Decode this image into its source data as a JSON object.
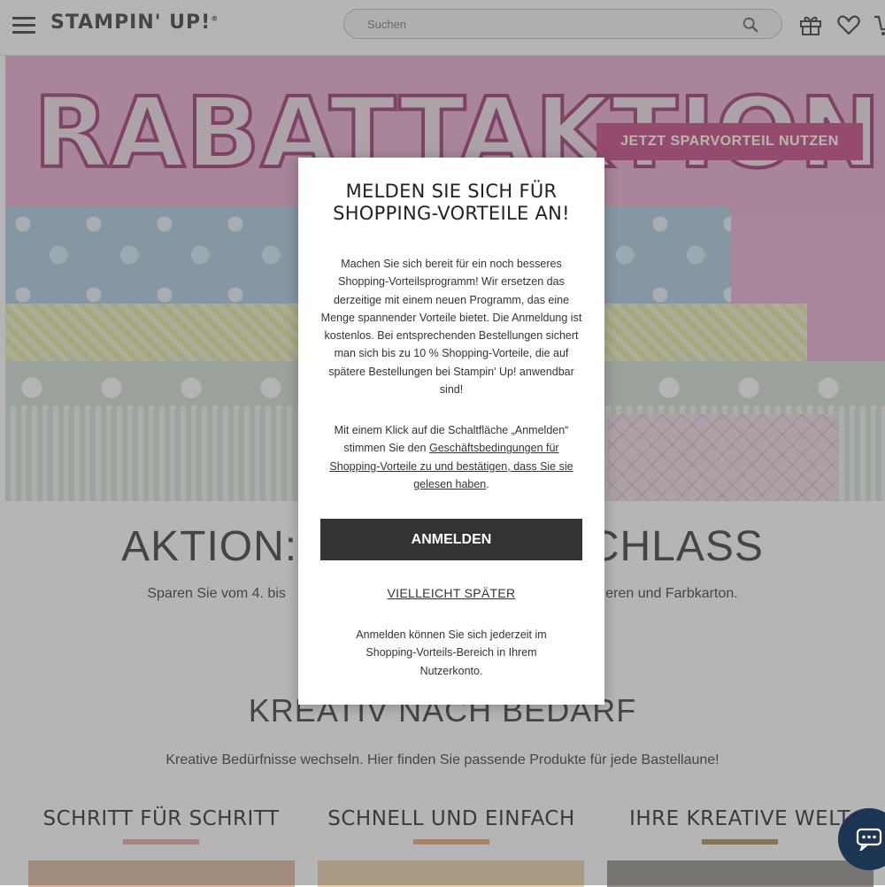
{
  "header": {
    "logo": "STAMPIN' UP!",
    "logo_mark": "®",
    "search_placeholder": "Suchen"
  },
  "icons": {
    "menu": "hamburger-icon",
    "search": "search-icon",
    "gift": "gift-icon",
    "wishlist": "heart-icon",
    "cart": "cart-icon",
    "chat": "chat-icon"
  },
  "hero": {
    "title": "RABATTAKTION",
    "button_label": "JETZT SPARVORTEIL NUTZEN"
  },
  "promo": {
    "heading": "AKTION: ... CHLASS",
    "heading_left": "AKTION:",
    "heading_right": "CHLASS",
    "subtitle_left": "Sparen Sie vom 4. bis",
    "subtitle_right": "pieren und Farbkarton."
  },
  "kreativ": {
    "heading": "KREATIV NACH BEDARF",
    "subtitle": "Kreative Bedürfnisse wechseln. Hier finden Sie passende Produkte für jede Bastellaune!"
  },
  "categories": [
    {
      "title": "SCHRITT FÜR SCHRITT",
      "color": "#e7a1ac"
    },
    {
      "title": "SCHNELL UND EINFACH",
      "color": "#e7a36a"
    },
    {
      "title": "IHRE KREATIVE WELT",
      "color": "#a58a5a"
    }
  ],
  "modal": {
    "title": "MELDEN SIE SICH FÜR SHOPPING-VORTEILE AN!",
    "body": "Machen Sie sich bereit für ein noch besseres Shopping-Vorteilsprogramm! Wir ersetzen das derzeitige mit einem neuen Programm, das eine Menge spannender Vorteile bietet. Die Anmeldung ist kostenlos. Bei entsprechenden Bestellungen sichert man sich bis zu 10 % Shopping-Vorteile, die auf spätere Bestellungen bei Stampin' Up! anwendbar sind!",
    "terms_prefix": "Mit einem Klick auf die Schaltfläche „Anmelden“ stimmen Sie den ",
    "terms_link": "Geschäftsbedingungen für Shopping-Vorteile zu und bestätigen, dass Sie sie gelesen haben",
    "terms_suffix": ".",
    "primary_button": "ANMELDEN",
    "later_link": "VIELLEICHT SPÄTER",
    "footer": "Anmelden können Sie sich jederzeit im Shopping-Vorteils-Bereich in Ihrem Nutzerkonto."
  },
  "colors": {
    "hero_button": "#c5407b",
    "modal_button": "#333333",
    "chat_bubble": "#1c3553"
  }
}
